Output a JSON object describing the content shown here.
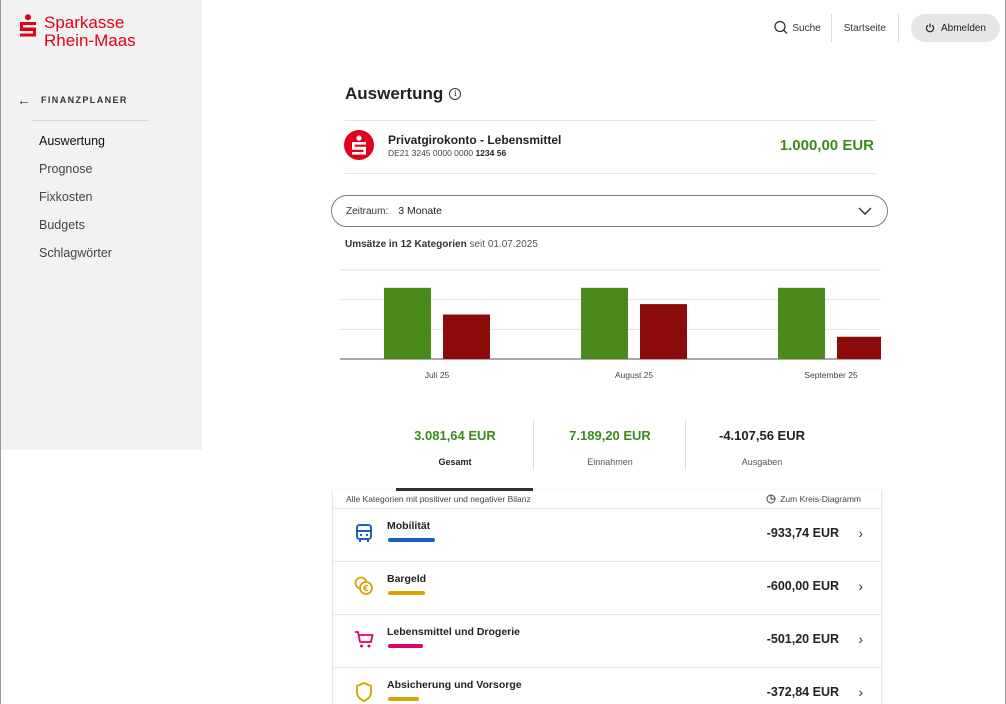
{
  "brand": {
    "line1": "Sparkasse",
    "line2": "Rhein-Maas",
    "color": "#e2001a"
  },
  "topbar": {
    "search_label": "Suche",
    "home_label": "Startseite",
    "logout_label": "Abmelden"
  },
  "sidebar": {
    "section_label": "FINANZPLANER",
    "items": [
      {
        "label": "Auswertung",
        "active": true
      },
      {
        "label": "Prognose"
      },
      {
        "label": "Fixkosten"
      },
      {
        "label": "Budgets"
      },
      {
        "label": "Schlagwörter"
      }
    ]
  },
  "main": {
    "title": "Auswertung",
    "account": {
      "name": "Privatgirokonto - Lebensmittel",
      "iban_prefix": "DE21 3245 0000 0000",
      "iban_suffix": "1234 56",
      "balance": "1.000,00 EUR"
    },
    "period": {
      "label": "Zeitraum:",
      "value": "3 Monate"
    },
    "subtitle": {
      "prefix": "Umsätze in 12 Kategorien",
      "suffix": "seit 01.07.2025"
    },
    "stats": [
      {
        "value": "3.081,64 EUR",
        "label": "Gesamt",
        "color": "#3c8a1d"
      },
      {
        "value": "7.189,20 EUR",
        "label": "Einnahmen",
        "color": "#3c8a1d"
      },
      {
        "value": "-4.107,56 EUR",
        "label": "Ausgaben",
        "color": "#222222"
      }
    ],
    "categories_header": "Alle Kategorien mit positiver und negativer Bilanz",
    "pie_link": "Zum Kreis-Diagramm",
    "categories": [
      {
        "label": "Mobilität",
        "amount": "-933,74 EUR",
        "color": "#1e5fbf",
        "icon": "bus-icon",
        "share": 1.0
      },
      {
        "label": "Bargeld",
        "amount": "-600,00 EUR",
        "color": "#d9a300",
        "icon": "coins-icon",
        "share": 0.64
      },
      {
        "label": "Lebensmittel und Drogerie",
        "amount": "-501,20 EUR",
        "color": "#e0006a",
        "icon": "cart-icon",
        "share": 0.54
      },
      {
        "label": "Absicherung und Vorsorge",
        "amount": "-372,84 EUR",
        "color": "#d9a300",
        "icon": "shield-icon",
        "share": 0.4
      }
    ]
  },
  "chart_data": {
    "type": "bar",
    "categories": [
      "Juli 25",
      "August 25",
      "September 25"
    ],
    "series": [
      {
        "values": [
          2400,
          2400,
          2400
        ],
        "color": "#4a8a1c"
      },
      {
        "values": [
          1500,
          1850,
          750
        ],
        "color": "#8b0b0b"
      }
    ],
    "ylim": [
      0,
      3000
    ],
    "grid": true
  }
}
